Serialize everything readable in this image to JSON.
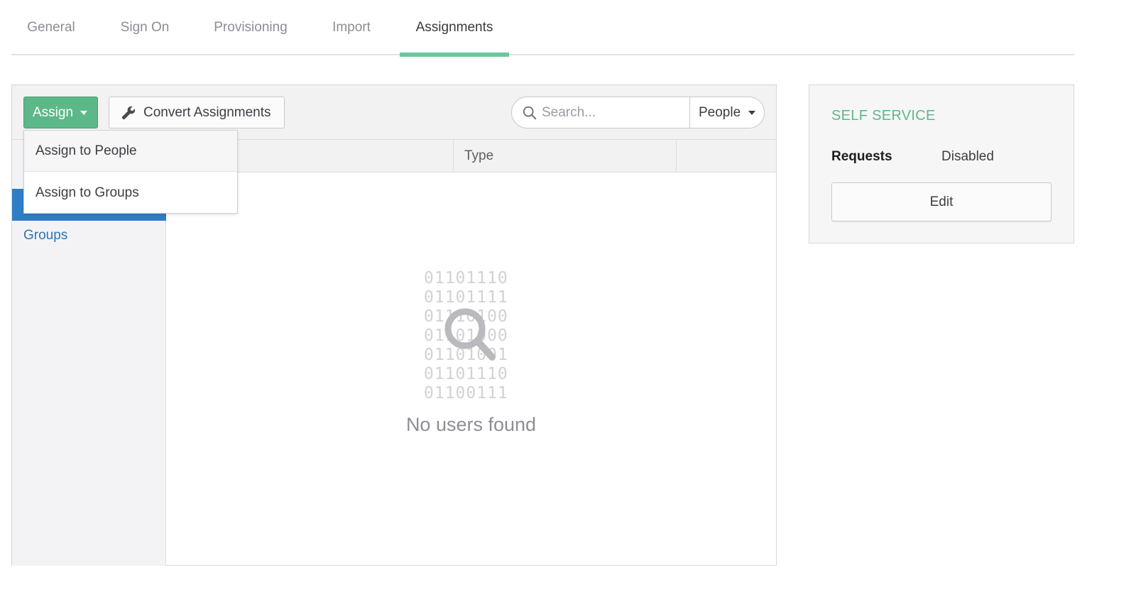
{
  "tabs": [
    {
      "label": "General"
    },
    {
      "label": "Sign On"
    },
    {
      "label": "Provisioning"
    },
    {
      "label": "Import"
    },
    {
      "label": "Assignments",
      "active": true
    }
  ],
  "toolbar": {
    "assign_label": "Assign",
    "convert_label": "Convert Assignments",
    "search_placeholder": "Search...",
    "filter_value": "People"
  },
  "assign_menu": {
    "items": [
      "Assign to People",
      "Assign to Groups"
    ]
  },
  "sidebar": {
    "groups_label": "Groups"
  },
  "table": {
    "columns": [
      "",
      "Type",
      ""
    ]
  },
  "empty_state": {
    "binary_lines": "01101110\n01101111\n01110100\n01101000\n01101001\n01101110\n01100111",
    "message": "No users found",
    "icon": "magnifier-icon"
  },
  "self_service": {
    "title": "SELF SERVICE",
    "requests_label": "Requests",
    "requests_value": "Disabled",
    "edit_label": "Edit"
  },
  "colors": {
    "accent_green": "#5cb888",
    "tab_underline": "#6fc59c",
    "sidebar_active": "#2f7dc7",
    "link_blue": "#2d73b4"
  }
}
